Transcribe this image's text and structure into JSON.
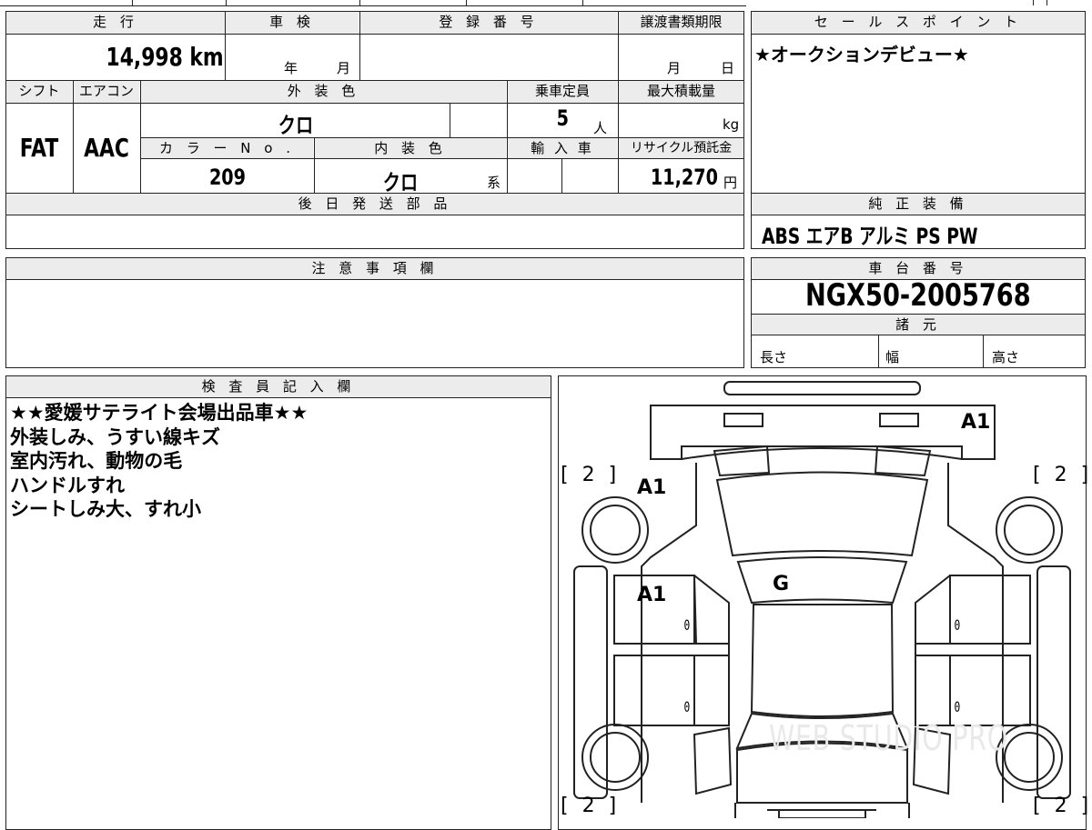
{
  "header": {
    "mileage_label": "走 行",
    "shaken_label": "車 検",
    "registration_label": "登 録 番 号",
    "transfer_deadline_label": "譲渡書類期限",
    "mileage_value": "14,998",
    "mileage_unit": "km",
    "shaken_year_unit": "年",
    "shaken_month_unit": "月",
    "deadline_month_unit": "月",
    "deadline_day_unit": "日"
  },
  "spec": {
    "shift_label": "シフト",
    "aircon_label": "エアコン",
    "exterior_color_label": "外 装 色",
    "capacity_label": "乗車定員",
    "max_load_label": "最大積載量",
    "shift_value": "FAT",
    "aircon_value": "AAC",
    "exterior_color_value": "クロ",
    "capacity_value": "5",
    "capacity_unit": "人",
    "max_load_unit": "kg",
    "color_no_label": "カ ラ ー N o .",
    "interior_color_label": "内 装 色",
    "import_label": "輸 入 車",
    "recycle_label": "リサイクル預託金",
    "color_no_value": "209",
    "interior_color_value": "クロ",
    "interior_suffix": "系",
    "recycle_value": "11,270",
    "recycle_unit": "円",
    "later_parts_label": "後 日 発 送 部 品"
  },
  "sales": {
    "label": "セ ー ル ス ポ イ ン ト",
    "text": "★オークションデビュー★"
  },
  "equipment": {
    "label": "純 正 装 備",
    "items": "ABS エアB アルミ PS PW"
  },
  "caution": {
    "label": "注 意 事 項 欄"
  },
  "chassis": {
    "label": "車 台 番 号",
    "value": "NGX50-2005768",
    "specs_label": "諸 元",
    "length_label": "長さ",
    "width_label": "幅",
    "height_label": "高さ"
  },
  "inspector": {
    "label": "検 査 員 記 入 欄",
    "lines": [
      "★★愛媛サテライト会場出品車★★",
      "外装しみ、うすい線キズ",
      "室内汚れ、動物の毛",
      "ハンドルすれ",
      "シートしみ大、すれ小"
    ]
  },
  "diagram": {
    "marks": {
      "rear_right": "A1",
      "left_front_fender": "A1",
      "left_front_door": "A1",
      "roof": "G"
    },
    "tire_top_left": "[ 2 ]",
    "tire_top_right": "[ 2 ]",
    "tire_bottom_left": "[ 2 ]",
    "tire_bottom_right": "[ 2 ]",
    "door_zero": "0",
    "watermark": "WEB STUDIO PRO"
  }
}
